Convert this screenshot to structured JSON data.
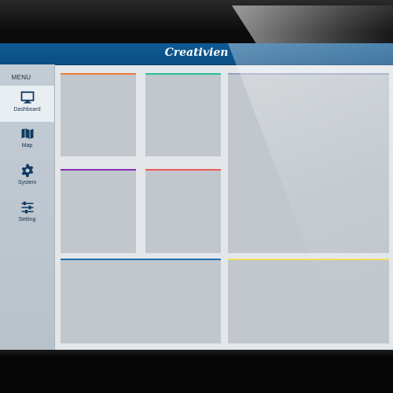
{
  "app": {
    "brand": "Creativien"
  },
  "sidebar": {
    "menu_label": "MENU",
    "items": [
      {
        "label": "Dashboard",
        "icon": "monitor-icon",
        "active": true
      },
      {
        "label": "Map",
        "icon": "map-icon",
        "active": false
      },
      {
        "label": "System",
        "icon": "gear-icon",
        "active": false
      },
      {
        "label": "Setting",
        "icon": "sliders-icon",
        "active": false
      }
    ]
  },
  "colors": {
    "topbar": "#0b4f86",
    "sidebar_bg": "#c3ccd4",
    "tile_bg": "#c1c7cc",
    "accent_orange": "#f07a3c",
    "accent_teal": "#2cc0a0",
    "accent_lavender": "#9a9ec8",
    "accent_purple": "#8a2fb8",
    "accent_red": "#f05a5a",
    "accent_blue": "#1c6fb5",
    "accent_yellow": "#f0e060"
  }
}
